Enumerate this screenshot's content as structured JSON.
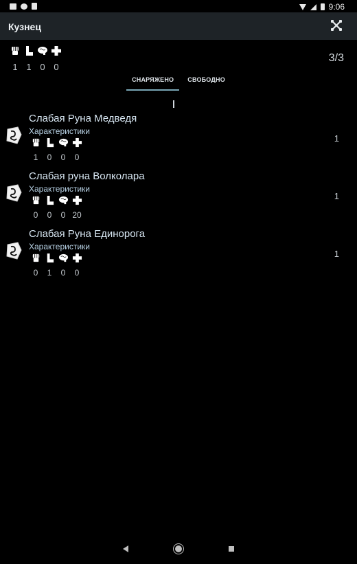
{
  "status_bar": {
    "time": "9:06",
    "left_icons": [
      "mail-icon",
      "circle-icon",
      "sd-card-icon"
    ],
    "right_icons": [
      "wifi-icon",
      "signal-icon",
      "battery-icon"
    ]
  },
  "app_bar": {
    "title": "Кузнец",
    "close_icon": "crossed-swords-icon"
  },
  "summary": {
    "icons": [
      "fist-icon",
      "boot-icon",
      "brain-icon",
      "plus-icon"
    ],
    "values": [
      "1",
      "1",
      "0",
      "0"
    ],
    "counter": "3/3"
  },
  "tabs": [
    {
      "label": "СНАРЯЖЕНО",
      "active": true
    },
    {
      "label": "СВОБОДНО",
      "active": false
    }
  ],
  "items": [
    {
      "name": "Слабая Руна Медведя",
      "subtitle": "Характеристики",
      "stats": [
        "1",
        "0",
        "0",
        "0"
      ],
      "qty": "1",
      "icon": "rune-stone-icon"
    },
    {
      "name": "Слабая руна Волколара",
      "subtitle": "Характеристики",
      "stats": [
        "0",
        "0",
        "0",
        "20"
      ],
      "qty": "1",
      "icon": "rune-stone-icon"
    },
    {
      "name": "Слабая Руна Единорога",
      "subtitle": "Характеристики",
      "stats": [
        "0",
        "1",
        "0",
        "0"
      ],
      "qty": "1",
      "icon": "rune-stone-icon"
    }
  ],
  "colors": {
    "background": "#000000",
    "app_bar": "#1e2327",
    "tab_indicator": "#7aa8b8",
    "item_name": "#d7e6f2",
    "item_subtitle": "#b9d3e6"
  }
}
